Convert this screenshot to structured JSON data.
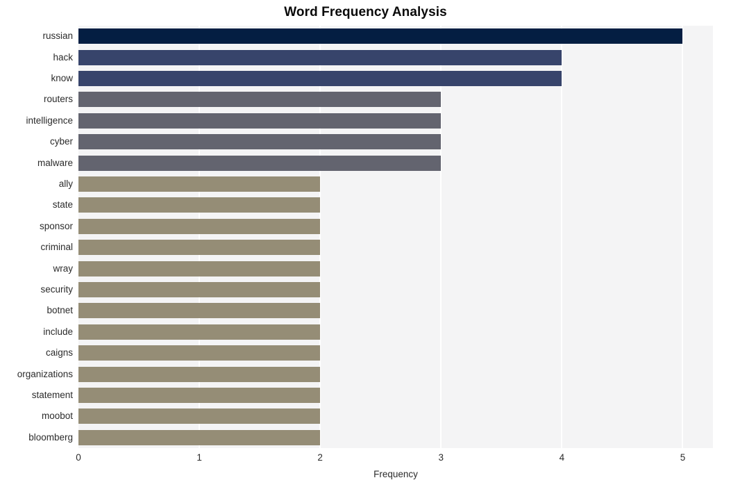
{
  "chart_data": {
    "type": "bar",
    "orientation": "horizontal",
    "title": "Word Frequency Analysis",
    "xlabel": "Frequency",
    "ylabel": "",
    "xlim": [
      0,
      5.25
    ],
    "xticks": [
      0,
      1,
      2,
      3,
      4,
      5
    ],
    "xtick_labels": [
      "0",
      "1",
      "2",
      "3",
      "4",
      "5"
    ],
    "grid": true,
    "grid_axis": "x",
    "legend": false,
    "categories": [
      "russian",
      "hack",
      "know",
      "routers",
      "intelligence",
      "cyber",
      "malware",
      "ally",
      "state",
      "sponsor",
      "criminal",
      "wray",
      "security",
      "botnet",
      "include",
      "caigns",
      "organizations",
      "statement",
      "moobot",
      "bloomberg"
    ],
    "values": [
      5,
      4,
      4,
      3,
      3,
      3,
      3,
      2,
      2,
      2,
      2,
      2,
      2,
      2,
      2,
      2,
      2,
      2,
      2,
      2
    ],
    "bar_colors": [
      "#041e42",
      "#37446b",
      "#37446b",
      "#63646f",
      "#63646f",
      "#63646f",
      "#63646f",
      "#958d76",
      "#958d76",
      "#958d76",
      "#958d76",
      "#958d76",
      "#958d76",
      "#958d76",
      "#958d76",
      "#958d76",
      "#958d76",
      "#958d76",
      "#958d76",
      "#958d76"
    ]
  },
  "style": {
    "plot_background": "#f4f4f5",
    "figure_background": "#ffffff",
    "gridline_color": "#ffffff",
    "text_color": "#2b2b2b",
    "title_color": "#0a0a0a"
  }
}
